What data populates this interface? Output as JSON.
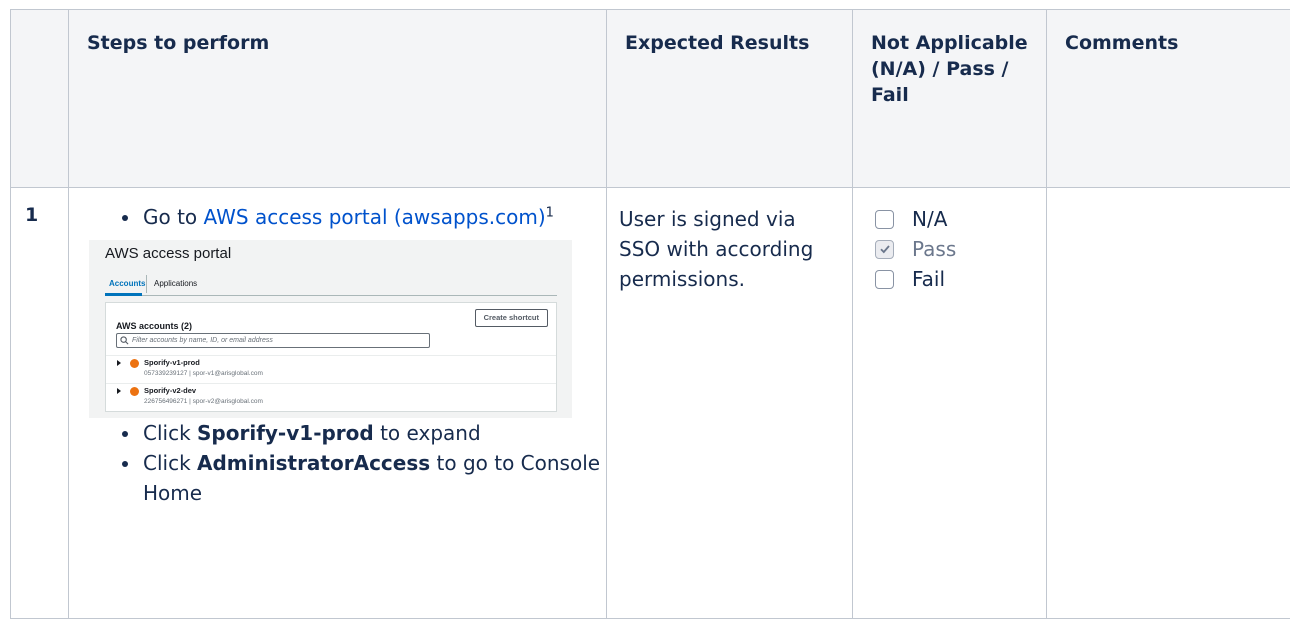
{
  "headers": {
    "num": "",
    "steps": "Steps to perform",
    "expected": "Expected Results",
    "status": "Not Applicable (N/A) / Pass / Fail",
    "comments": "Comments"
  },
  "row": {
    "number": "1",
    "step1_prefix": "Go to ",
    "step1_link": "AWS access portal (awsapps.com)",
    "step1_footnote": "1",
    "step2_prefix": "Click ",
    "step2_bold": "Sporify-v1-prod",
    "step2_suffix": " to expand",
    "step3_prefix": "Click ",
    "step3_bold": "AdministratorAccess",
    "step3_suffix": " to go to Console Home",
    "expected": "User is signed via SSO with according permissions.",
    "options": [
      {
        "label": "N/A",
        "checked": false
      },
      {
        "label": "Pass",
        "checked": true
      },
      {
        "label": "Fail",
        "checked": false
      }
    ],
    "comments": ""
  },
  "portal": {
    "title": "AWS access portal",
    "tab_accounts": "Accounts",
    "tab_applications": "Applications",
    "panel_title": "AWS accounts (2)",
    "create_shortcut": "Create shortcut",
    "filter_placeholder": "Filter accounts by name, ID, or email address",
    "accounts": [
      {
        "name": "Sporify-v1-prod",
        "detail": "057339239127 | spor-v1@arisglobal.com"
      },
      {
        "name": "Sporify-v2-dev",
        "detail": "226756496271 | spor-v2@arisglobal.com"
      }
    ]
  },
  "colors": {
    "link": "#0052cc",
    "header_bg": "#f4f5f7",
    "accent_orange": "#ec7211"
  }
}
